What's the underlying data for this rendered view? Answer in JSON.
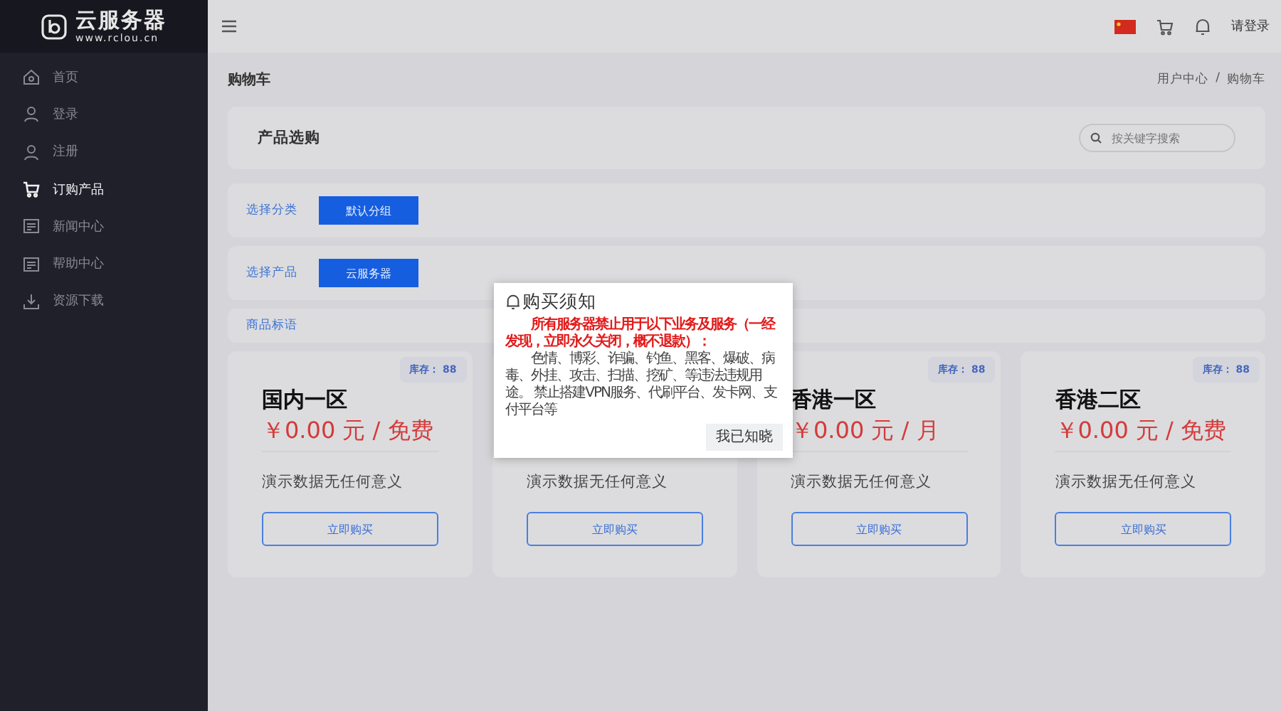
{
  "brand": {
    "name": "云服务器",
    "url": "www.rclou.cn"
  },
  "sidebar": {
    "items": [
      {
        "label": "首页",
        "kind": "home",
        "selected": false
      },
      {
        "label": "登录",
        "kind": "user",
        "selected": false
      },
      {
        "label": "注册",
        "kind": "user",
        "selected": false
      },
      {
        "label": "订购产品",
        "kind": "cart",
        "selected": true
      },
      {
        "label": "新闻中心",
        "kind": "document",
        "selected": false
      },
      {
        "label": "帮助中心",
        "kind": "document",
        "selected": false
      },
      {
        "label": "资源下载",
        "kind": "download",
        "selected": false
      }
    ]
  },
  "topbar": {
    "login": "请登录"
  },
  "page": {
    "title": "购物车",
    "breadcrumb": [
      "用户中心",
      "购物车"
    ],
    "breadcrumb_separator": "/"
  },
  "product_select": {
    "title": "产品选购",
    "search": {
      "placeholder": "按关键字搜索"
    }
  },
  "filters": [
    {
      "label": "选择分类",
      "option": "默认分组"
    },
    {
      "label": "选择产品",
      "option": "云服务器"
    }
  ],
  "tagline_label": "商品标语",
  "products": [
    {
      "stock": "库存： 88",
      "title": "国内一区",
      "price": "￥0.00 元 / 免费",
      "description": "演示数据无任何意义",
      "button": "立即购买"
    },
    {
      "description": "演示数据无任何意义",
      "button": "立即购买"
    },
    {
      "stock": "库存： 88",
      "title": "香港一区",
      "price": "￥0.00 元 / 月",
      "description": "演示数据无任何意义",
      "button": "立即购买"
    },
    {
      "stock": "库存： 88",
      "title": "香港二区",
      "price": "￥0.00 元 / 免费",
      "description": "演示数据无任何意义",
      "button": "立即购买"
    }
  ],
  "modal": {
    "title": "购买须知",
    "warning": "所有服务器禁止用于以下业务及服务（一经发现，立即永久关闭，概不退款）：",
    "body": "色情、博彩、诈骗、钓鱼、黑客、爆破、病毒、外挂、攻击、扫描、挖矿、等违法违规用途。 禁止搭建VPN服务、代刷平台、发卡网、支付平台等",
    "button": "我已知晓"
  }
}
